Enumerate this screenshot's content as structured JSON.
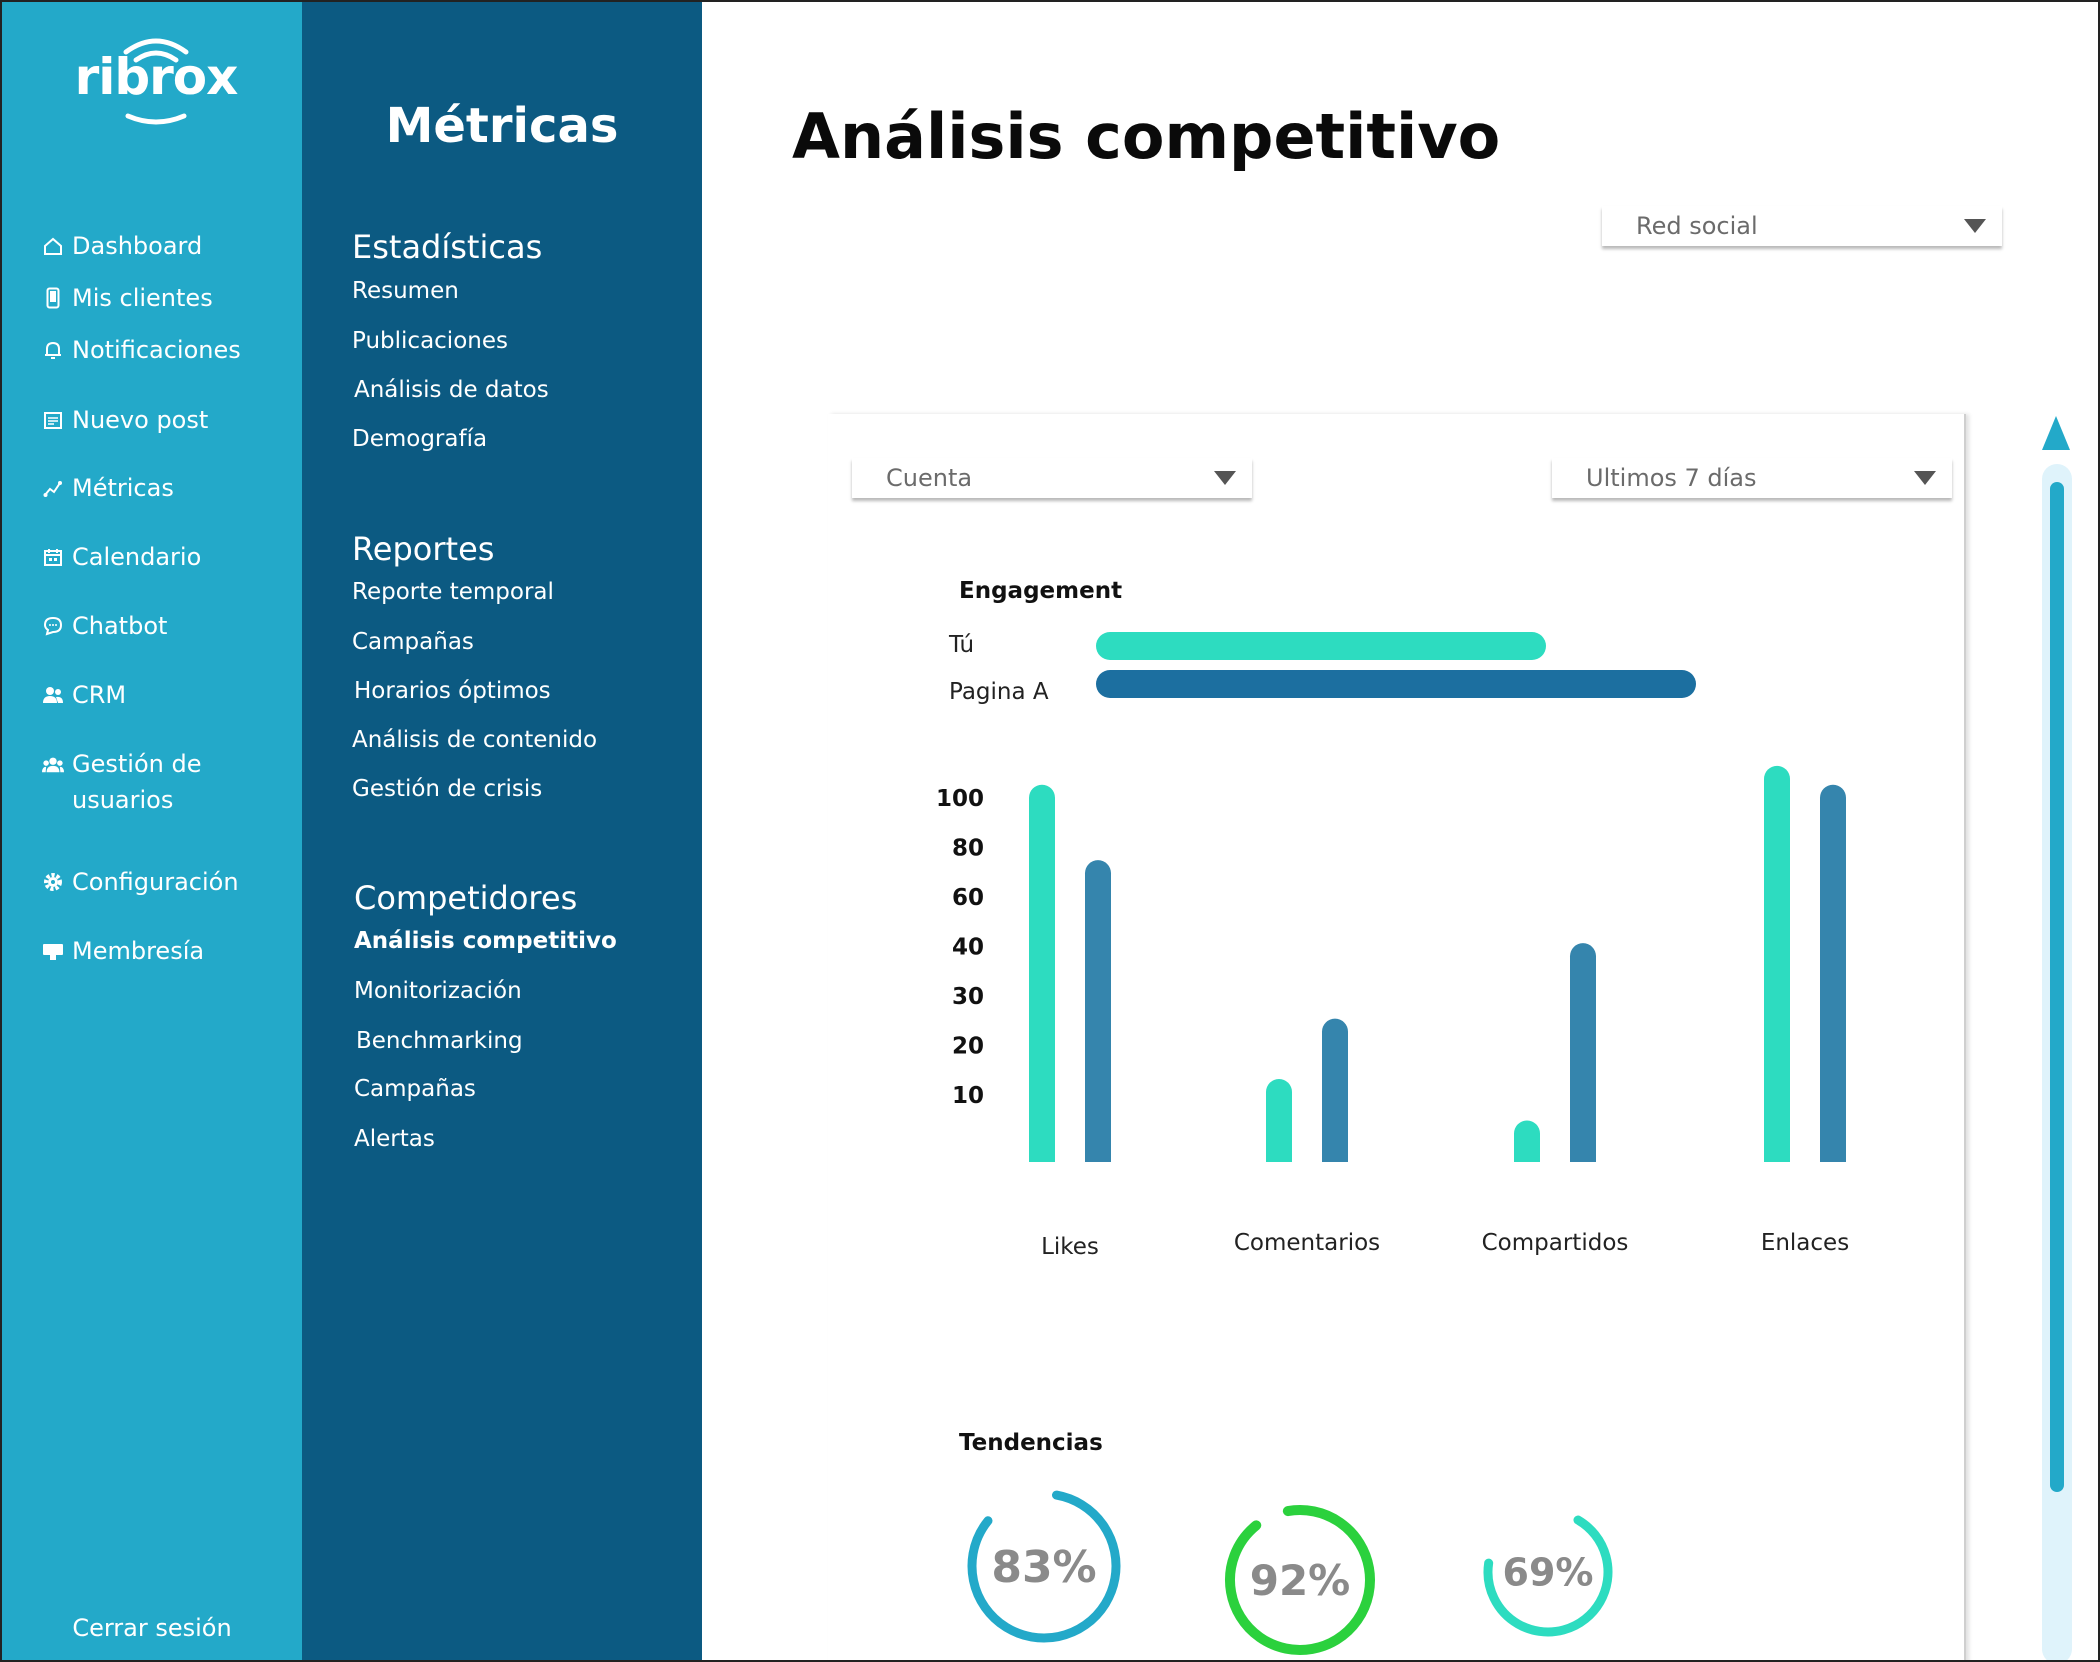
{
  "brand": {
    "logo_text": "ribrox"
  },
  "sidebar": {
    "items": [
      {
        "label": "Dashboard",
        "icon": "home-icon"
      },
      {
        "label": "Mis clientes",
        "icon": "phone-icon"
      },
      {
        "label": "Notificaciones",
        "icon": "bell-icon"
      },
      {
        "label": "Nuevo post",
        "icon": "post-icon"
      },
      {
        "label": "Métricas",
        "icon": "metrics-icon"
      },
      {
        "label": "Calendario",
        "icon": "calendar-icon"
      },
      {
        "label": "Chatbot",
        "icon": "chat-icon"
      },
      {
        "label": "CRM",
        "icon": "users-icon"
      },
      {
        "label_line1": "Gestión de",
        "label_line2": "usuarios",
        "icon": "user-management-icon"
      },
      {
        "label": "Configuración",
        "icon": "gear-icon"
      },
      {
        "label": "Membresía",
        "icon": "membership-icon"
      }
    ],
    "logout": "Cerrar sesión"
  },
  "subnav": {
    "title": "Métricas",
    "sections": [
      {
        "title": "Estadísticas",
        "items": [
          "Resumen",
          "Publicaciones",
          "Análisis de datos",
          "Demografía"
        ]
      },
      {
        "title": "Reportes",
        "items": [
          "Reporte temporal",
          "Campañas",
          "Horarios óptimos",
          "Análisis de contenido",
          "Gestión de crisis"
        ]
      },
      {
        "title": "Competidores",
        "items": [
          "Análisis competitivo",
          "Monitorización",
          "Benchmarking",
          "Campañas",
          "Alertas"
        ]
      }
    ],
    "active_item": "Análisis competitivo"
  },
  "main": {
    "title": "Análisis competitivo",
    "filters": {
      "network": "Red social",
      "account": "Cuenta",
      "period": "Ultimos 7 días"
    },
    "engagement": {
      "title": "Engagement",
      "rows": [
        {
          "label": "Tú",
          "value": 0.75,
          "color": "#2ddcc0"
        },
        {
          "label": "Pagina A",
          "value": 1.0,
          "color": "#1c6fa0"
        }
      ]
    },
    "trends": {
      "title": "Tendencias",
      "gauges": [
        {
          "label": "83%",
          "value": 83,
          "color": "#23a9c9"
        },
        {
          "label": "92%",
          "value": 92,
          "color": "#2bd13d"
        },
        {
          "label": "69%",
          "value": 69,
          "color": "#2ddcc0"
        }
      ]
    }
  },
  "chart_data": {
    "type": "bar",
    "categories": [
      "Likes",
      "Comentarios",
      "Compartidos",
      "Enlaces"
    ],
    "series": [
      {
        "values": [
          100,
          22,
          11,
          105
        ],
        "color": "#2ddcc0"
      },
      {
        "values": [
          80,
          38,
          58,
          100
        ],
        "color": "#3585ad"
      }
    ],
    "yticks": [
      "100",
      "80",
      "60",
      "40",
      "30",
      "20",
      "10"
    ],
    "ylim": [
      0,
      110
    ],
    "grid": false,
    "title": "",
    "xlabel": "",
    "ylabel": ""
  }
}
